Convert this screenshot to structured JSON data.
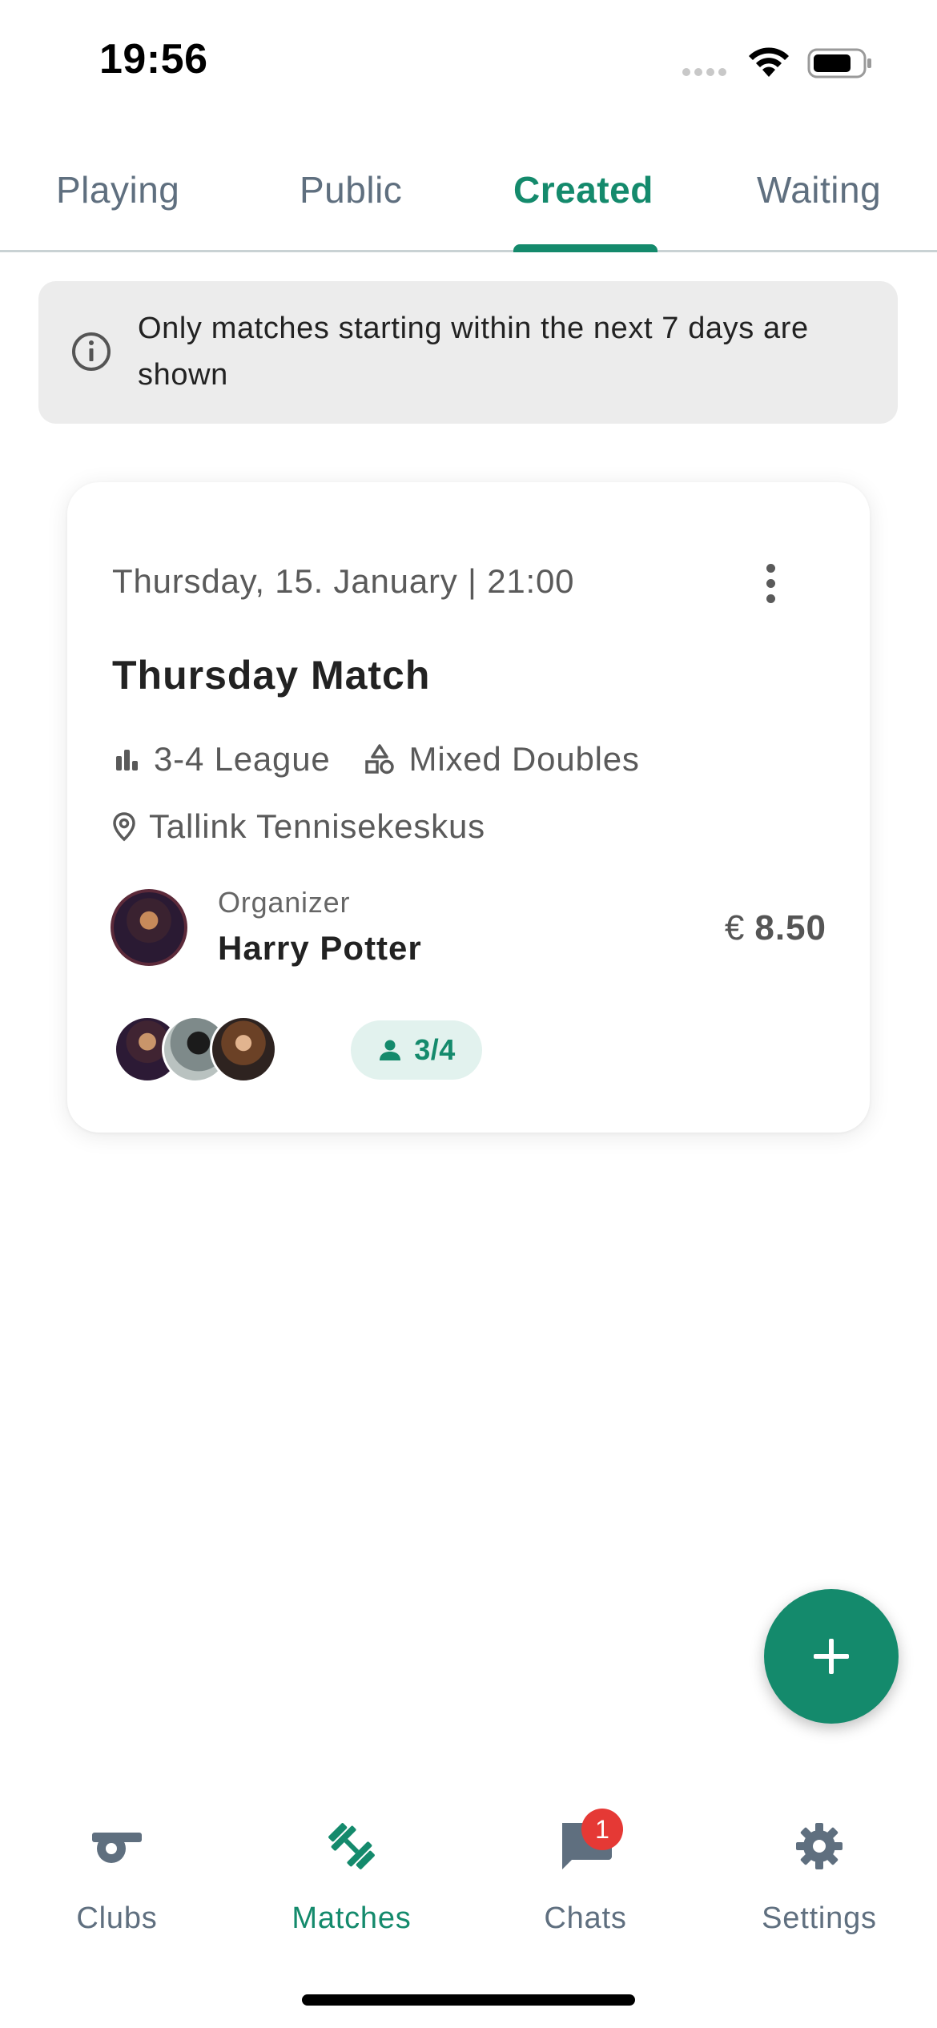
{
  "status_bar": {
    "time": "19:56"
  },
  "tabs": [
    {
      "label": "Playing"
    },
    {
      "label": "Public"
    },
    {
      "label": "Created",
      "active": true
    },
    {
      "label": "Waiting"
    }
  ],
  "info_banner": {
    "text": "Only matches starting within the next 7 days are shown"
  },
  "match": {
    "date": "Thursday, 15. January | 21:00",
    "title": "Thursday Match",
    "level": "3-4 League",
    "type": "Mixed Doubles",
    "location": "Tallink Tennisekeskus",
    "organizer_label": "Organizer",
    "organizer_name": "Harry Potter",
    "currency": "€",
    "price": "8.50",
    "participants": "3/4"
  },
  "bottom_nav": [
    {
      "label": "Clubs",
      "icon": "whistle-icon"
    },
    {
      "label": "Matches",
      "icon": "dumbbell-icon",
      "active": true
    },
    {
      "label": "Chats",
      "icon": "chat-icon",
      "badge": "1"
    },
    {
      "label": "Settings",
      "icon": "gear-icon"
    }
  ],
  "colors": {
    "accent": "#148a6c",
    "muted": "#5f6f7f",
    "badge": "#e53935"
  }
}
